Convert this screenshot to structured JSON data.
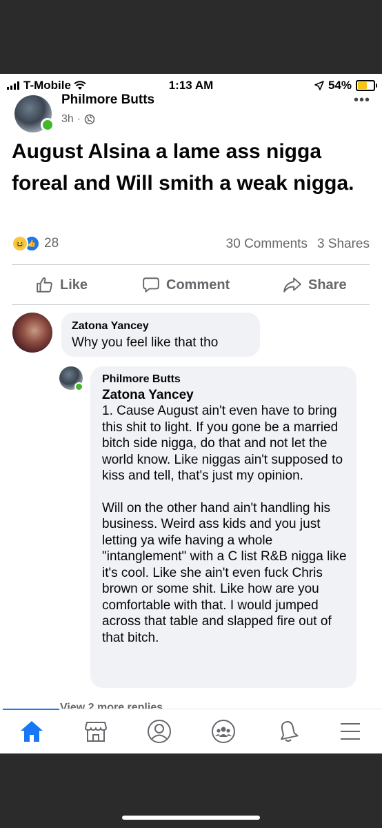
{
  "status_bar": {
    "carrier": "T-Mobile",
    "time": "1:13 AM",
    "battery": "54%",
    "icons": [
      "signal-icon",
      "wifi-icon",
      "location-arrow-icon",
      "battery-icon"
    ]
  },
  "post": {
    "author": "Philmore Butts",
    "time": "3h",
    "audience_icon": "globe-icon",
    "text": "August Alsina a lame ass nigga foreal and Will smith a weak nigga.",
    "reaction_count": "28",
    "comments_count": "30 Comments",
    "shares_count": "3 Shares"
  },
  "actions": {
    "like": "Like",
    "comment": "Comment",
    "share": "Share"
  },
  "comments": [
    {
      "author": "Zatona Yancey",
      "text": "Why you feel like that tho"
    }
  ],
  "reply": {
    "author": "Philmore Butts",
    "mention": "Zatona Yancey",
    "paragraph1": "1. Cause August ain't even have to bring this shit to light. If you gone be a married bitch side nigga, do that and not let the world know. Like niggas ain't supposed to kiss and tell, that's just my opinion.",
    "paragraph2": "Will on the other hand ain't handling his business. Weird ass kids and you just letting ya wife having a whole \"intanglement\" with a C list R&B nigga like it's cool. Like she ain't even fuck Chris brown or some shit. Like how are you comfortable with that. I would jumped across that table and slapped fire out of that bitch."
  },
  "view_more": "View 2 more replies",
  "nav": [
    "home-icon",
    "marketplace-icon",
    "profile-icon",
    "groups-icon",
    "notifications-icon",
    "menu-icon"
  ],
  "colors": {
    "accent": "#1877f2",
    "online": "#42b72a",
    "secondary_text": "#65676b",
    "bubble": "#f0f2f5",
    "frame": "#2b2b2b"
  }
}
